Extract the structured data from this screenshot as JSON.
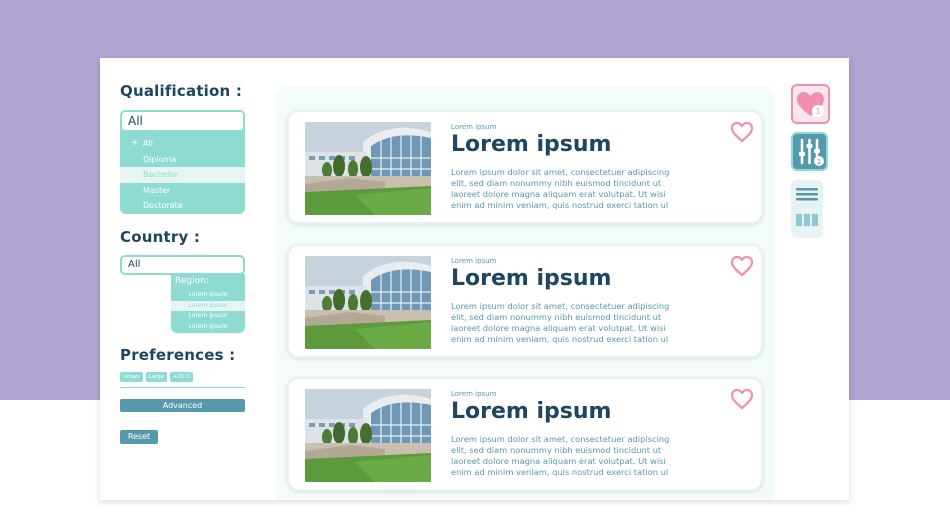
{
  "colors": {
    "background": "#b0a3d1",
    "navy": "#1f4660",
    "mint": "#8ddbd1",
    "teal": "#5699ad",
    "pink": "#f18fb0"
  },
  "sidebar": {
    "qualification": {
      "title": "Qualification :",
      "value": "All",
      "options": [
        {
          "label": "All",
          "icon": "plus-icon"
        },
        {
          "label": "Diploma"
        },
        {
          "label": "Bachelor",
          "selected": true
        },
        {
          "label": "Master"
        },
        {
          "label": "Doctorate"
        }
      ]
    },
    "country": {
      "title": "Country :",
      "value": "All",
      "region_label": "Region:",
      "regions": [
        "Lorem ipsum",
        "Lorem ipsum",
        "Lorem ipsum",
        "Lorem ipsum"
      ]
    },
    "preferences": {
      "title": "Preferences :",
      "tags": [
        "Urban",
        "Large",
        "+20 C"
      ],
      "advanced_label": "Advanced",
      "reset_label": "Reset"
    }
  },
  "results": [
    {
      "subtitle": "Lorem ipsum",
      "title": "Lorem ipsum",
      "text": "Lorem ipsum dolor sit amet, consectetuer adipiscing elit, sed diam nonummy nibh euismod tincidunt ut laoreet dolore magna aliquam erat volutpat. Ut wisi enim ad minim veniam, quis nostrud exerci tation ul"
    },
    {
      "subtitle": "Lorem ipsum",
      "title": "Lorem ipsum",
      "text": "Lorem ipsum dolor sit amet, consectetuer adipiscing elit, sed diam nonummy nibh euismod tincidunt ut laoreet dolore magna aliquam erat volutpat. Ut wisi enim ad minim veniam, quis nostrud exerci tation ul"
    },
    {
      "subtitle": "Lorem ipsum",
      "title": "Lorem ipsum",
      "text": "Lorem ipsum dolor sit amet, consectetuer adipiscing elit, sed diam nonummy nibh euismod tincidunt ut laoreet dolore magna aliquam erat volutpat. Ut wisi enim ad minim veniam, quis nostrud exerci tation ul"
    }
  ],
  "rail": {
    "wishlist_count": "1",
    "filter_count": "1"
  }
}
